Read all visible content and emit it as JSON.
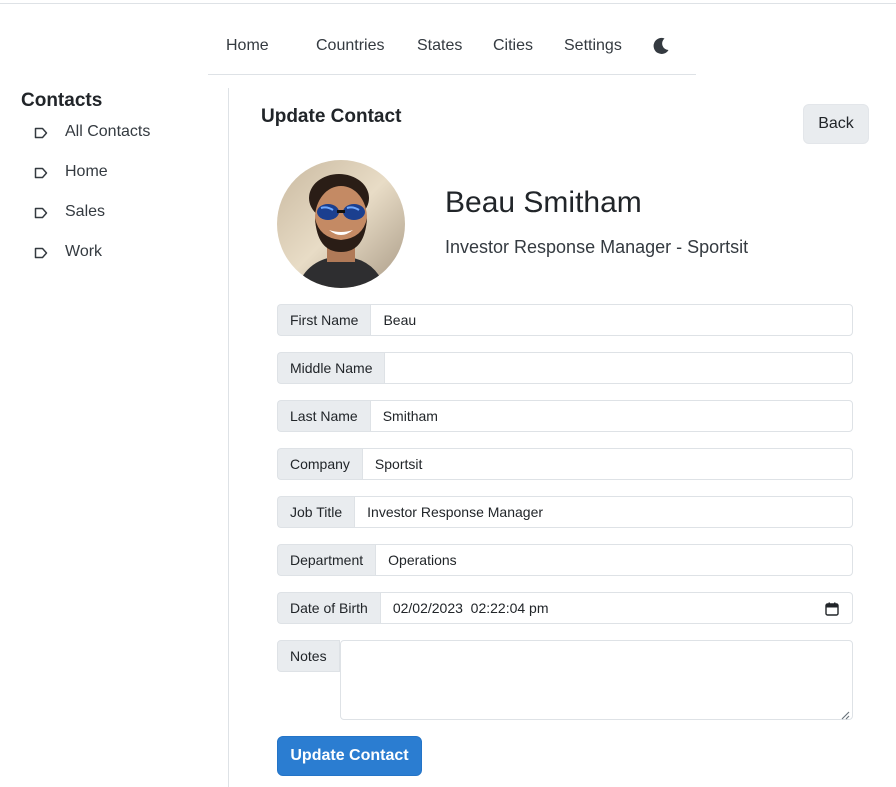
{
  "nav": {
    "items": [
      {
        "label": "Home"
      },
      {
        "label": "Countries"
      },
      {
        "label": "States"
      },
      {
        "label": "Cities"
      },
      {
        "label": "Settings"
      }
    ],
    "theme_icon": "moon-icon"
  },
  "sidebar": {
    "title": "Contacts",
    "items": [
      {
        "label": "All Contacts",
        "icon": "tag-icon"
      },
      {
        "label": "Home",
        "icon": "tag-icon"
      },
      {
        "label": "Sales",
        "icon": "tag-icon"
      },
      {
        "label": "Work",
        "icon": "tag-icon"
      }
    ]
  },
  "main": {
    "title": "Update Contact",
    "back_label": "Back",
    "contact": {
      "name": "Beau Smitham",
      "subtitle": "Investor Response Manager - Sportsit"
    },
    "fields": {
      "first_name": {
        "label": "First Name",
        "value": "Beau"
      },
      "middle_name": {
        "label": "Middle Name",
        "value": ""
      },
      "last_name": {
        "label": "Last Name",
        "value": "Smitham"
      },
      "company": {
        "label": "Company",
        "value": "Sportsit"
      },
      "job_title": {
        "label": "Job Title",
        "value": "Investor Response Manager"
      },
      "department": {
        "label": "Department",
        "value": "Operations"
      },
      "dob": {
        "label": "Date of Birth",
        "value": "02/02/2023  02:22:04 pm"
      },
      "notes": {
        "label": "Notes",
        "value": ""
      }
    },
    "submit_label": "Update Contact"
  },
  "colors": {
    "primary": "#2b7dd1",
    "addon_bg": "#e9ecef",
    "border": "#dee2e6"
  }
}
